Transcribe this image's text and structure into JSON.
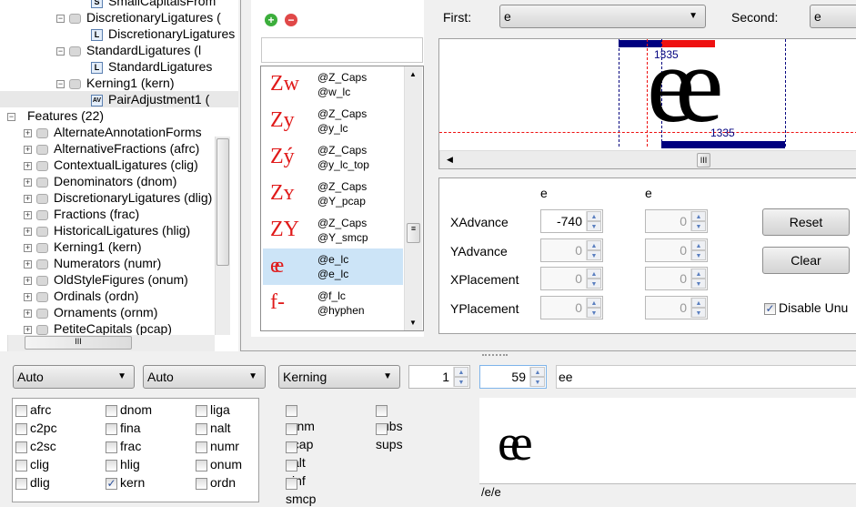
{
  "tree": {
    "lookups": [
      {
        "label": "SmallCapitalsFrom",
        "icon": "s-lookup-icon",
        "level": 2
      },
      {
        "label": "DiscretionaryLigatures (",
        "icon": "feature-cube-icon",
        "level": 1,
        "expander": "−"
      },
      {
        "label": "DiscretionaryLigatures",
        "icon": "ligature-lookup-icon",
        "level": 2
      },
      {
        "label": "StandardLigatures (l",
        "icon": "feature-cube-icon",
        "level": 1,
        "expander": "−"
      },
      {
        "label": "StandardLigatures",
        "icon": "ligature-lookup-icon",
        "level": 2
      },
      {
        "label": "Kerning1 (kern)",
        "icon": "feature-cube-icon",
        "level": 1,
        "expander": "−"
      },
      {
        "label": "PairAdjustment1 (",
        "icon": "pair-adjustment-icon",
        "level": 2,
        "selected": true
      }
    ],
    "features_label": "Features (22)",
    "features": [
      "AlternateAnnotationForms",
      "AlternativeFractions (afrc)",
      "ContextualLigatures (clig)",
      "Denominators (dnom)",
      "DiscretionaryLigatures (dlig)",
      "Fractions (frac)",
      "HistoricalLigatures (hlig)",
      "Kerning1 (kern)",
      "Numerators (numr)",
      "OldStyleFigures (onum)",
      "Ordinals (ordn)",
      "Ornaments (ornm)",
      "PetiteCapitals (pcap)"
    ]
  },
  "pairs": {
    "search_value": "",
    "items": [
      {
        "glyph": "Zw",
        "first": "@Z_Caps",
        "second": "@w_lc"
      },
      {
        "glyph": "Zy",
        "first": "@Z_Caps",
        "second": "@y_lc"
      },
      {
        "glyph": "Zý",
        "first": "@Z_Caps",
        "second": "@y_lc_top"
      },
      {
        "glyph": "Zʏ",
        "first": "@Z_Caps",
        "second": "@Y_pcap"
      },
      {
        "glyph": "ZY",
        "first": "@Z_Caps",
        "second": "@Y_smcp"
      },
      {
        "glyph": "ee",
        "first": "@e_lc",
        "second": "@e_lc",
        "selected": true
      },
      {
        "glyph": "f-",
        "first": "@f_lc",
        "second": "@hyphen"
      }
    ]
  },
  "editor": {
    "first_label": "First:",
    "first_value": "e",
    "second_label": "Second:",
    "second_value": "e",
    "preview_text": "ee",
    "width_top": "1335",
    "width_bottom": "1335",
    "col1": "e",
    "col2": "e",
    "rows": [
      {
        "label": "XAdvance",
        "v1": "-740",
        "v2": "0"
      },
      {
        "label": "YAdvance",
        "v1": "0",
        "v2": "0"
      },
      {
        "label": "XPlacement",
        "v1": "0",
        "v2": "0"
      },
      {
        "label": "YPlacement",
        "v1": "0",
        "v2": "0"
      }
    ],
    "reset": "Reset",
    "clear": "Clear",
    "disable_label": "Disable Unu",
    "disable_checked": true
  },
  "bottom": {
    "script": "Auto",
    "language": "Auto",
    "feature": "Kerning",
    "count": "1",
    "size": "59",
    "text": "ee",
    "preview": "ee",
    "status": "/e/e",
    "features": [
      [
        "afrc",
        "c2pc",
        "c2sc",
        "clig",
        "dlig"
      ],
      [
        "dnom",
        "fina",
        "frac",
        "hlig",
        "kern"
      ],
      [
        "liga",
        "nalt",
        "numr",
        "onum",
        "ordn"
      ],
      [
        "ornm",
        "pcap",
        "salt",
        "sinf",
        "smcp"
      ],
      [
        "subs",
        "sups"
      ]
    ],
    "checked": [
      "kern"
    ]
  },
  "colors": {
    "selection": "#cce4f7",
    "accent_red": "#e01a1a",
    "bar_blue": "#00007f"
  }
}
